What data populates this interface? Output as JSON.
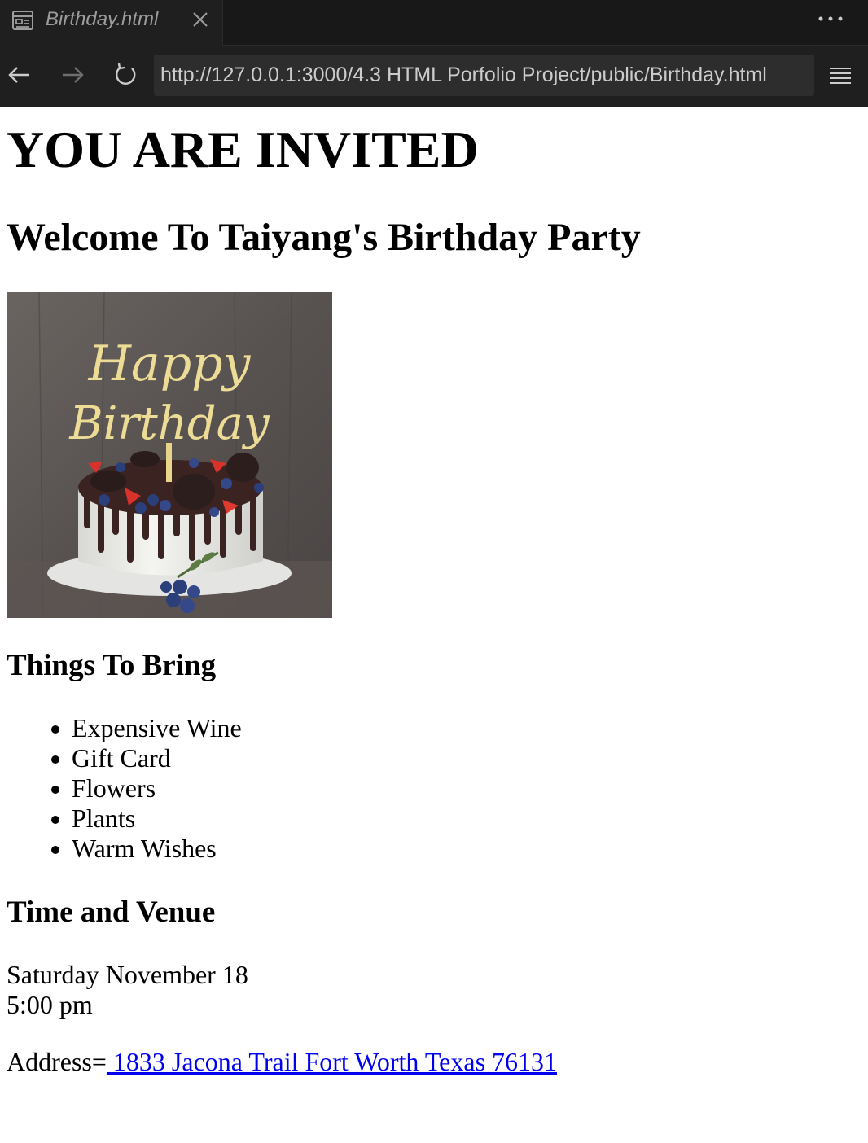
{
  "tab": {
    "title": "Birthday.html"
  },
  "browser": {
    "url": "http://127.0.0.1:3000/4.3 HTML Porfolio Project/public/Birthday.html"
  },
  "icons": {
    "tab": "preview-icon",
    "close": "close-icon",
    "more": "more-horizontal-icon",
    "back": "arrow-left-icon",
    "forward": "arrow-right-icon",
    "reload": "refresh-icon",
    "menu": "hamburger-menu-icon"
  },
  "colors": {
    "chrome_bg": "#1f1f1f",
    "tabbar_bg": "#181818",
    "link": "#0000ee"
  },
  "page": {
    "heading": "YOU ARE INVITED",
    "subheading": "Welcome To Taiyang's Birthday Party",
    "image_text": "Happy Birthday",
    "things_heading": "Things To Bring",
    "things": [
      "Expensive Wine",
      "Gift Card",
      "Flowers",
      "Plants",
      "Warm Wishes"
    ],
    "venue_heading": "Time and Venue",
    "date": "Saturday November 18",
    "time": "5:00 pm",
    "address_label": "Address=",
    "address_link": " 1833 Jacona Trail Fort Worth Texas 76131"
  }
}
